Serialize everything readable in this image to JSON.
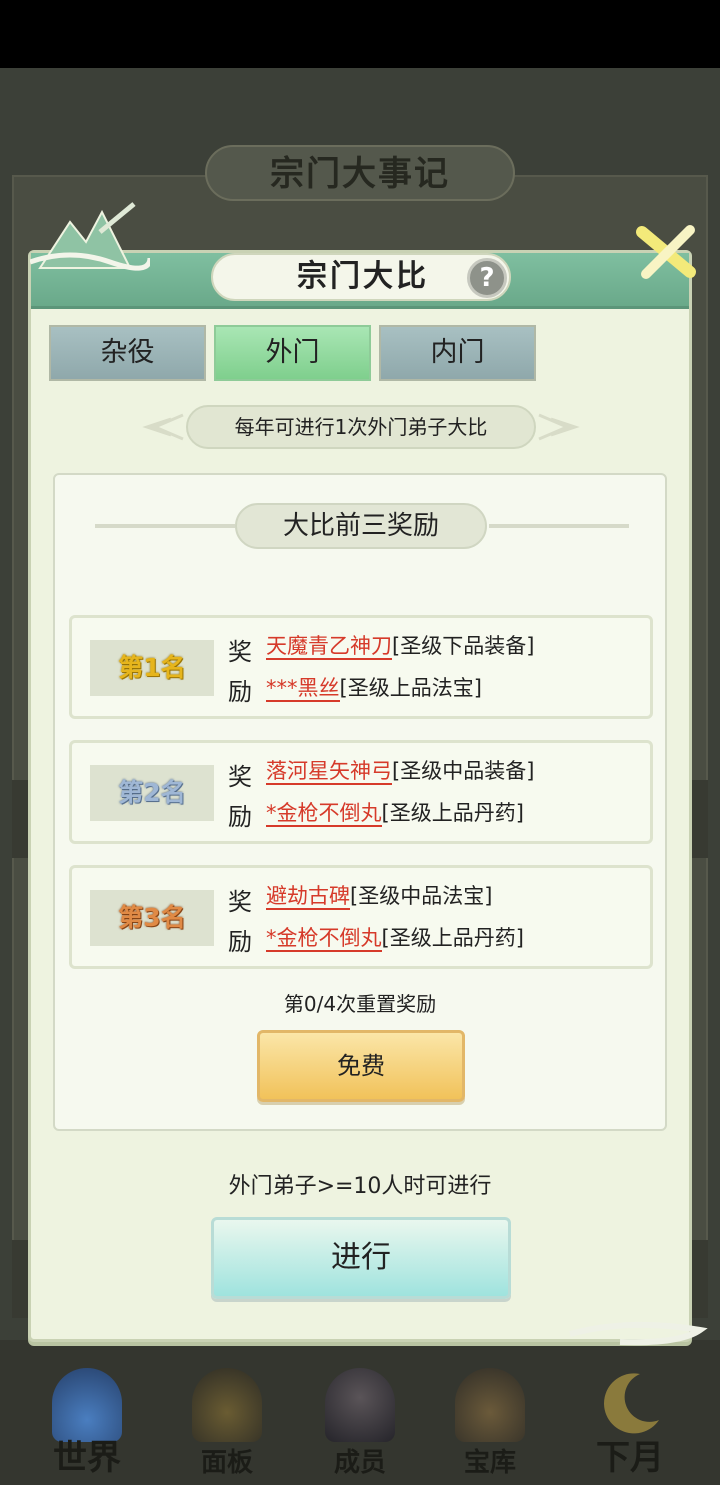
{
  "background": {
    "title": "宗门大事记",
    "nav": [
      {
        "label": "世界",
        "icon": "world-temple-icon"
      },
      {
        "label": "面板",
        "icon": "panel-gate-icon"
      },
      {
        "label": "成员",
        "icon": "member-person-icon"
      },
      {
        "label": "宝库",
        "icon": "treasury-icon"
      },
      {
        "label": "下月",
        "icon": "moon-icon"
      }
    ]
  },
  "dialog": {
    "title": "宗门大比",
    "help_label": "?",
    "tabs": [
      {
        "label": "杂役",
        "active": false
      },
      {
        "label": "外门",
        "active": true
      },
      {
        "label": "内门",
        "active": false
      }
    ],
    "notice": "每年可进行1次外门弟子大比",
    "reward_section_title": "大比前三奖励",
    "ranks": [
      {
        "rank_label": "第1名",
        "reward_label": "奖励",
        "items": [
          {
            "name": "天魔青乙神刀",
            "grade": "[圣级下品装备]"
          },
          {
            "name": "***黑丝",
            "grade": "[圣级上品法宝]"
          }
        ]
      },
      {
        "rank_label": "第2名",
        "reward_label": "奖励",
        "items": [
          {
            "name": "落河星矢神弓",
            "grade": "[圣级中品装备]"
          },
          {
            "name": "*金枪不倒丸",
            "grade": "[圣级上品丹药]"
          }
        ]
      },
      {
        "rank_label": "第3名",
        "reward_label": "奖励",
        "items": [
          {
            "name": "避劫古碑",
            "grade": "[圣级中品法宝]"
          },
          {
            "name": "*金枪不倒丸",
            "grade": "[圣级上品丹药]"
          }
        ]
      }
    ],
    "reset_text": "第0/4次重置奖励",
    "free_button": "免费",
    "requirement_text": "外门弟子>=10人时可进行",
    "proceed_button": "进行"
  },
  "colors": {
    "header_green": "#6aa98a",
    "tab_active": "#7fcf8d",
    "reward_red": "#d63a2a",
    "free_gold": "#f1c25a",
    "go_teal": "#9fe3de"
  }
}
